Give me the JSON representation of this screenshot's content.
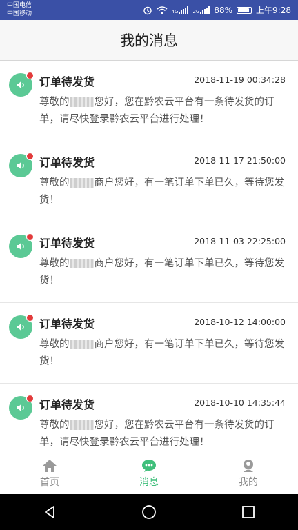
{
  "status_bar": {
    "carrier1": "中国电信",
    "carrier2": "中国移动",
    "network1": "4G",
    "network2": "2G",
    "battery": "88%",
    "time": "上午9:28"
  },
  "header": {
    "title": "我的消息"
  },
  "messages": [
    {
      "title": "订单待发货",
      "time": "2018-11-19 00:34:28",
      "body_pre": "尊敬的",
      "body_post": "您好，您在黔农云平台有一条待发货的订单，请尽快登录黔农云平台进行处理！"
    },
    {
      "title": "订单待发货",
      "time": "2018-11-17 21:50:00",
      "body_pre": "尊敬的",
      "body_post": "商户您好，有一笔订单下单已久，等待您发货！"
    },
    {
      "title": "订单待发货",
      "time": "2018-11-03 22:25:00",
      "body_pre": "尊敬的",
      "body_post": "商户您好，有一笔订单下单已久，等待您发货！"
    },
    {
      "title": "订单待发货",
      "time": "2018-10-12 14:00:00",
      "body_pre": "尊敬的",
      "body_post": "商户您好，有一笔订单下单已久，等待您发货！"
    },
    {
      "title": "订单待发货",
      "time": "2018-10-10 14:35:44",
      "body_pre": "尊敬的",
      "body_post": "您好，您在黔农云平台有一条待发货的订单，请尽快登录黔农云平台进行处理！"
    }
  ],
  "tabs": [
    {
      "label": "首页",
      "icon": "home-icon",
      "active": false
    },
    {
      "label": "消息",
      "icon": "chat-icon",
      "active": true
    },
    {
      "label": "我的",
      "icon": "user-icon",
      "active": false
    }
  ],
  "colors": {
    "accent": "#3fbf7b",
    "status_bar": "#3a50a6",
    "unread_dot": "#e23b3b"
  }
}
